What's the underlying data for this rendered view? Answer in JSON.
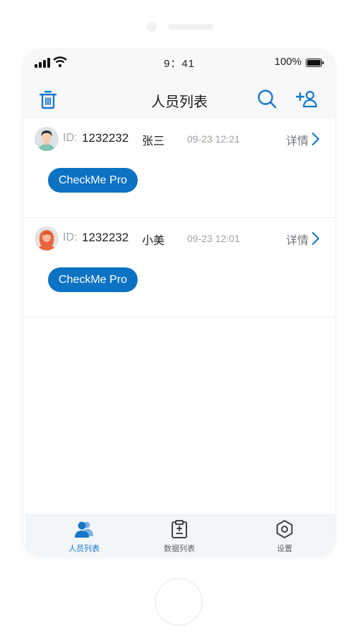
{
  "status_bar": {
    "time": "9：41",
    "battery": "100%"
  },
  "nav": {
    "title": "人员列表",
    "icons": [
      "trash-icon",
      "search-icon",
      "add-user-icon"
    ]
  },
  "list": {
    "id_label": "ID:",
    "detail_label": "详情",
    "items": [
      {
        "id": "1232232",
        "name": "张三",
        "date": "09-23 12:21",
        "device": "CheckMe Pro",
        "avatar": "male-avatar"
      },
      {
        "id": "1232232",
        "name": "小美",
        "date": "09-23 12:01",
        "device": "CheckMe Pro",
        "avatar": "female-avatar"
      }
    ]
  },
  "tab_bar": {
    "tabs": [
      {
        "label": "人员列表",
        "icon": "people-icon",
        "active": true
      },
      {
        "label": "数据列表",
        "icon": "clipboard-icon",
        "active": false
      },
      {
        "label": "设置",
        "icon": "settings-icon",
        "active": false
      }
    ]
  },
  "colors": {
    "accent": "#0b72c4",
    "tab_active": "#1877c9",
    "bar_bg": "#f6f8fa"
  }
}
